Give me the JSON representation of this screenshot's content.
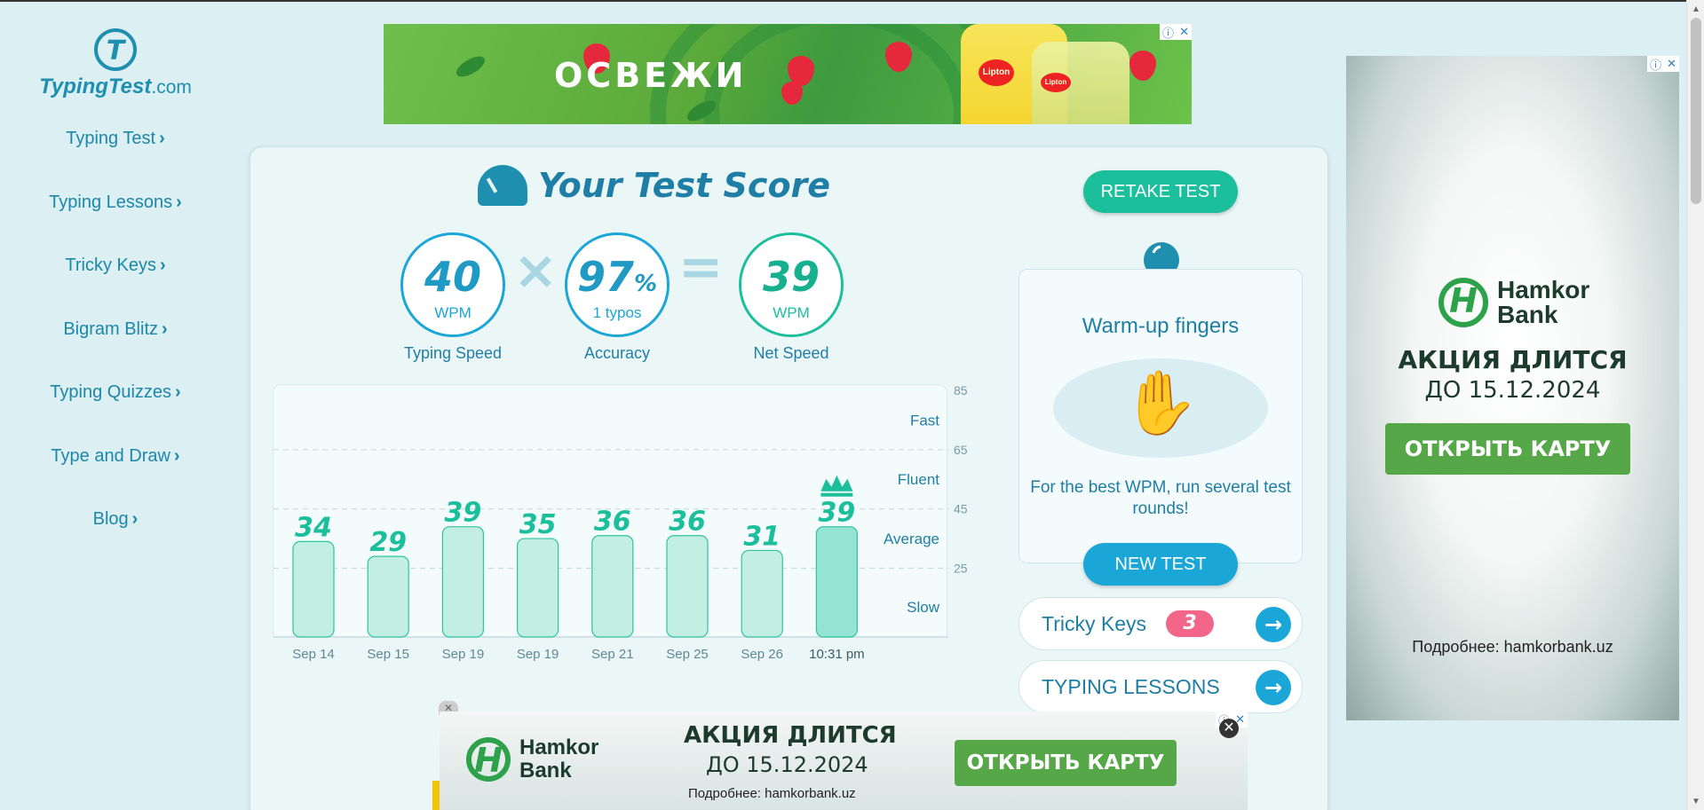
{
  "brand": {
    "name": "TypingTest",
    "tld": ".com",
    "logo_letter": "T"
  },
  "nav": [
    {
      "label": "Typing Test"
    },
    {
      "label": "Typing Lessons"
    },
    {
      "label": "Tricky Keys"
    },
    {
      "label": "Bigram Blitz"
    },
    {
      "label": "Typing Quizzes"
    },
    {
      "label": "Type and Draw"
    },
    {
      "label": "Blog"
    }
  ],
  "ad_top": {
    "text": "ОСВЕЖИ",
    "brand": "Lipton"
  },
  "ad_right": {
    "brand_line1": "Hamkor",
    "brand_line2": "Bank",
    "promo1": "АКЦИЯ ДЛИТСЯ",
    "promo2": "ДО 15.12.2024",
    "button": "ОТКРЫТЬ КАРТУ",
    "more": "Подробнее: hamkorbank.uz"
  },
  "ad_bottom": {
    "brand_line1": "Hamkor",
    "brand_line2": "Bank",
    "promo1": "АКЦИЯ ДЛИТСЯ",
    "promo2": "ДО 15.12.2024",
    "button": "ОТКРЫТЬ КАРТУ",
    "more": "Подробнее: hamkorbank.uz"
  },
  "score": {
    "title": "Your Test Score",
    "retake": "RETAKE TEST",
    "speed": {
      "value": "40",
      "unit": "WPM",
      "label": "Typing Speed"
    },
    "accuracy": {
      "value": "97",
      "pct": "%",
      "sub": "1 typos",
      "label": "Accuracy"
    },
    "net": {
      "value": "39",
      "unit": "WPM",
      "label": "Net Speed"
    },
    "op_times": "×",
    "op_equals": "="
  },
  "chart_data": {
    "type": "bar",
    "categories": [
      "Sep 14",
      "Sep 15",
      "Sep 19",
      "Sep 19",
      "Sep 21",
      "Sep 25",
      "Sep 26",
      "10:31 pm"
    ],
    "values": [
      34,
      29,
      39,
      35,
      36,
      36,
      31,
      39
    ],
    "highlight_index": 7,
    "y_ticks": [
      25,
      45,
      65,
      85
    ],
    "ylim": [
      0,
      85
    ],
    "zones": [
      "Slow",
      "Average",
      "Fluent",
      "Fast"
    ],
    "grid": "dashed horizontal",
    "colors": {
      "bar": "#c2efe2",
      "bar_highlight": "#93e4d2",
      "bar_stroke": "#2ec49d",
      "label": "#1bbf9c"
    }
  },
  "tip": {
    "title": "Warm-up fingers",
    "text": "For the best WPM, run several test rounds!",
    "button": "NEW TEST"
  },
  "tricky": {
    "label": "Tricky Keys",
    "count": "3"
  },
  "lessons": {
    "label": "TYPING LESSONS"
  },
  "colors": {
    "teal": "#1bbf9c",
    "blue": "#1aa6d6",
    "pink": "#f2668a",
    "bank_green": "#55a747"
  }
}
